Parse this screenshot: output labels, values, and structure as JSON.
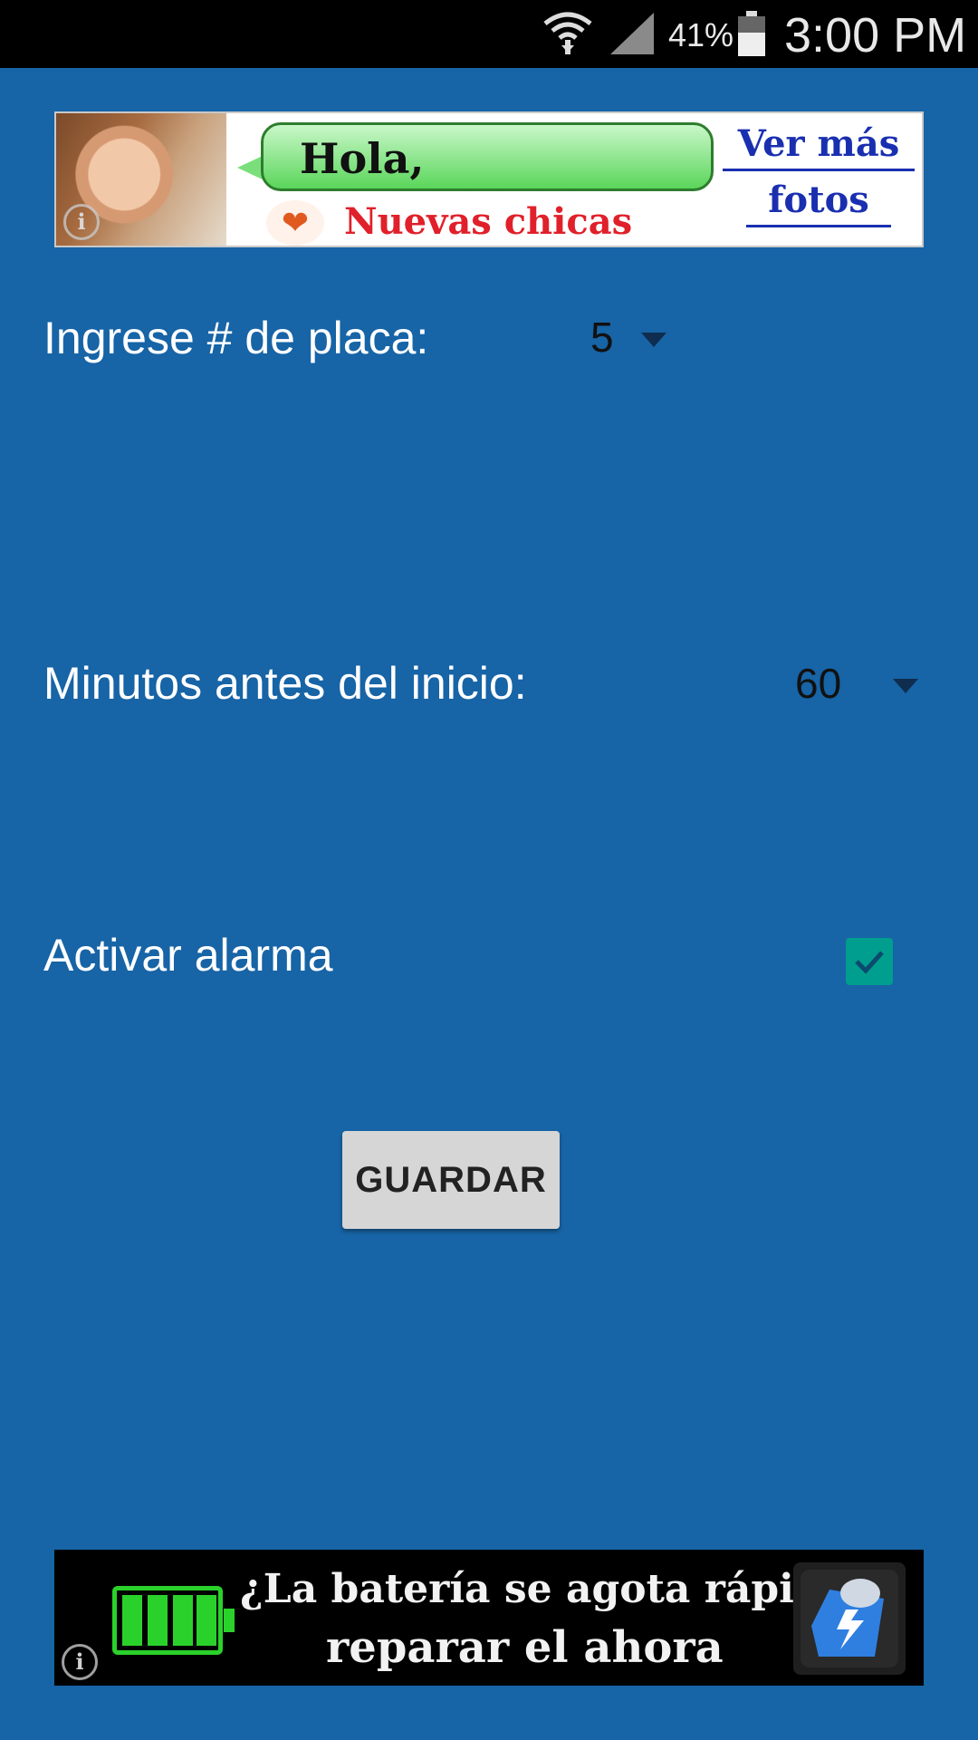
{
  "status_bar": {
    "battery_percent": "41%",
    "time": "3:00 PM",
    "icons": [
      "wifi-icon",
      "signal-icon",
      "battery-icon"
    ]
  },
  "ad_top": {
    "bubble_text": "Hola,",
    "subtext": "Nuevas chicas",
    "cta_line1": "Ver más",
    "cta_line2": "fotos",
    "info_symbol": "i"
  },
  "form": {
    "plate_label": "Ingrese # de placa:",
    "plate_value": "5",
    "minutes_label": "Minutos antes del inicio:",
    "minutes_value": "60",
    "alarm_label": "Activar alarma",
    "alarm_checked": true,
    "save_label": "GUARDAR"
  },
  "ad_bottom": {
    "line1": "¿La batería se agota rápido?",
    "line2": "reparar el ahora",
    "info_symbol": "i"
  },
  "colors": {
    "background": "#1764a6",
    "checkbox": "#009e8e",
    "button": "#d6d6d6"
  }
}
